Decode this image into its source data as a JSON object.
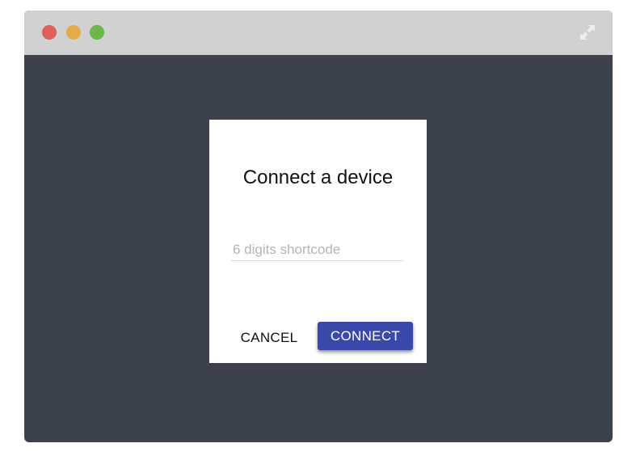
{
  "window": {
    "traffic_lights": {
      "close_color": "#e0605b",
      "minimize_color": "#e6aa4b",
      "maximize_color": "#6bb74a"
    },
    "expand_icon": "expand-arrows-icon",
    "background_color": "#3c414b"
  },
  "dialog": {
    "title": "Connect a device",
    "shortcode": {
      "placeholder": "6 digits shortcode",
      "value": ""
    },
    "cancel_label": "CANCEL",
    "connect_label": "CONNECT",
    "accent_color": "#3949ab"
  }
}
